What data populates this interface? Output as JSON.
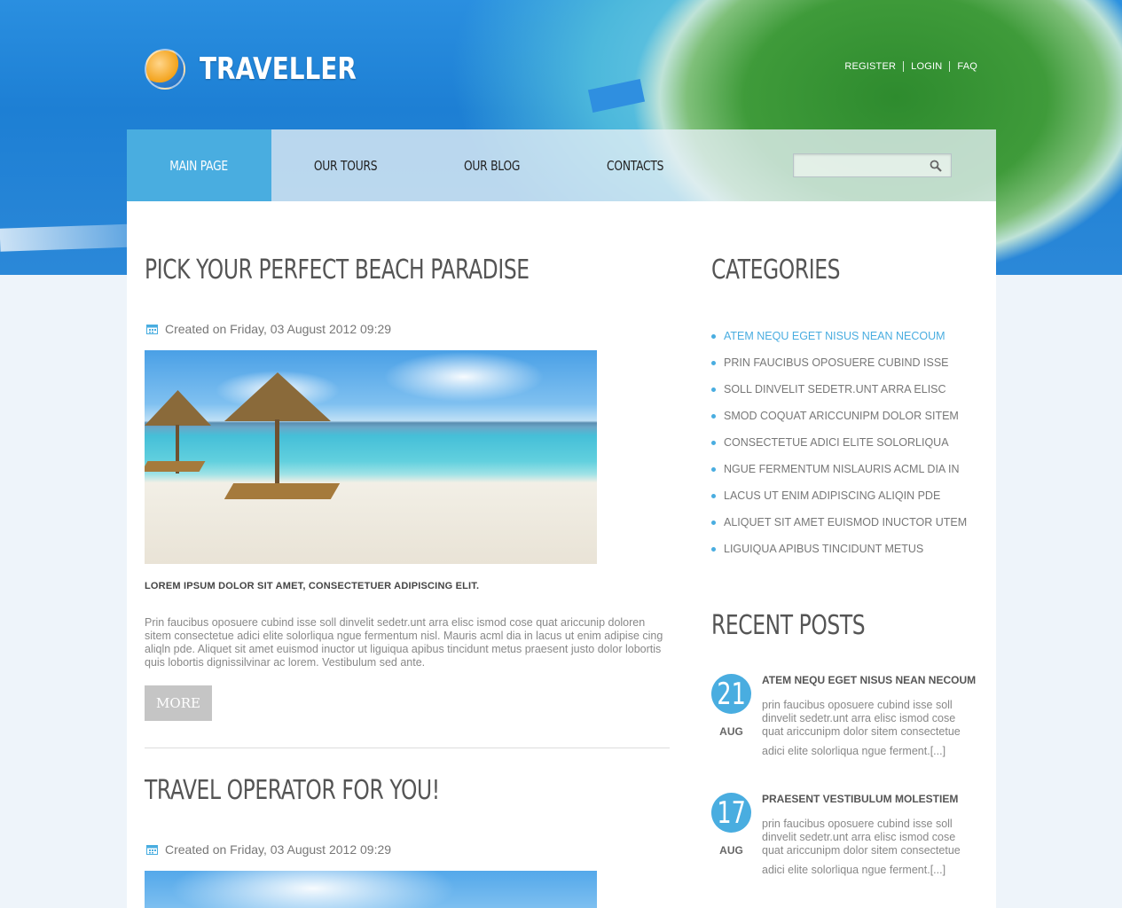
{
  "brand": {
    "name": "TRAVELLER"
  },
  "toplinks": [
    "REGISTER",
    "LOGIN",
    "FAQ"
  ],
  "nav": {
    "items": [
      "MAIN PAGE",
      "OUR TOURS",
      "OUR BLOG",
      "CONTACTS"
    ],
    "active": "MAIN PAGE",
    "search_placeholder": ""
  },
  "posts": [
    {
      "title": "PICK YOUR PERFECT BEACH PARADISE",
      "meta": "Created on Friday, 03 August 2012 09:29",
      "lead": "LOREM IPSUM DOLOR SIT AMET, CONSECTETUER ADIPISCING ELIT.",
      "body": "Prin faucibus oposuere cubind isse soll dinvelit sedetr.unt arra elisc ismod cose quat ariccunip doloren sitem consectetue adici elite solorliqua ngue fermentum nisl. Mauris acml dia in lacus ut enim adipise cing aliqln pde. Aliquet sit amet euismod inuctor ut liguiqua apibus tincidunt metus praesent justo dolor lobortis quis lobortis dignissilvinar ac lorem. Vestibulum sed ante.",
      "more": "MORE"
    },
    {
      "title": "TRAVEL OPERATOR FOR YOU!",
      "meta": "Created on Friday, 03 August 2012 09:29"
    }
  ],
  "sidebar": {
    "categories_title": "CATEGORIES",
    "categories": [
      "ATEM NEQU EGET NISUS NEAN NECOUM",
      "PRIN FAUCIBUS OPOSUERE CUBIND ISSE",
      "SOLL DINVELIT SEDETR.UNT ARRA ELISC",
      "SMOD COQUAT ARICCUNIPM DOLOR SITEM",
      "CONSECTETUE ADICI ELITE SOLORLIQUA",
      "NGUE FERMENTUM NISLAURIS ACML DIA IN",
      "LACUS UT ENIM ADIPISCING ALIQIN PDE",
      "ALIQUET SIT AMET EUISMOD INUCTOR UTEM",
      "LIGUIQUA APIBUS TINCIDUNT METUS"
    ],
    "recent_title": "RECENT POSTS",
    "recent": [
      {
        "day": "21",
        "month": "AUG",
        "title": "ATEM NEQU EGET NISUS NEAN NECOUM",
        "text": "prin faucibus oposuere cubind isse soll dinvelit sedetr.unt arra elisc ismod cose quat ariccunipm dolor sitem consectetue",
        "text2": "adici elite solorliqua ngue ferment.[...]"
      },
      {
        "day": "17",
        "month": "AUG",
        "title": "PRAESENT VESTIBULUM MOLESTIEM",
        "text": "prin faucibus oposuere cubind isse soll dinvelit sedetr.unt arra elisc ismod cose quat ariccunipm dolor sitem consectetue",
        "text2": "adici elite solorliqua ngue ferment.[...]"
      }
    ]
  },
  "colors": {
    "accent": "#49ade0",
    "heading": "#555555",
    "text": "#888888"
  }
}
